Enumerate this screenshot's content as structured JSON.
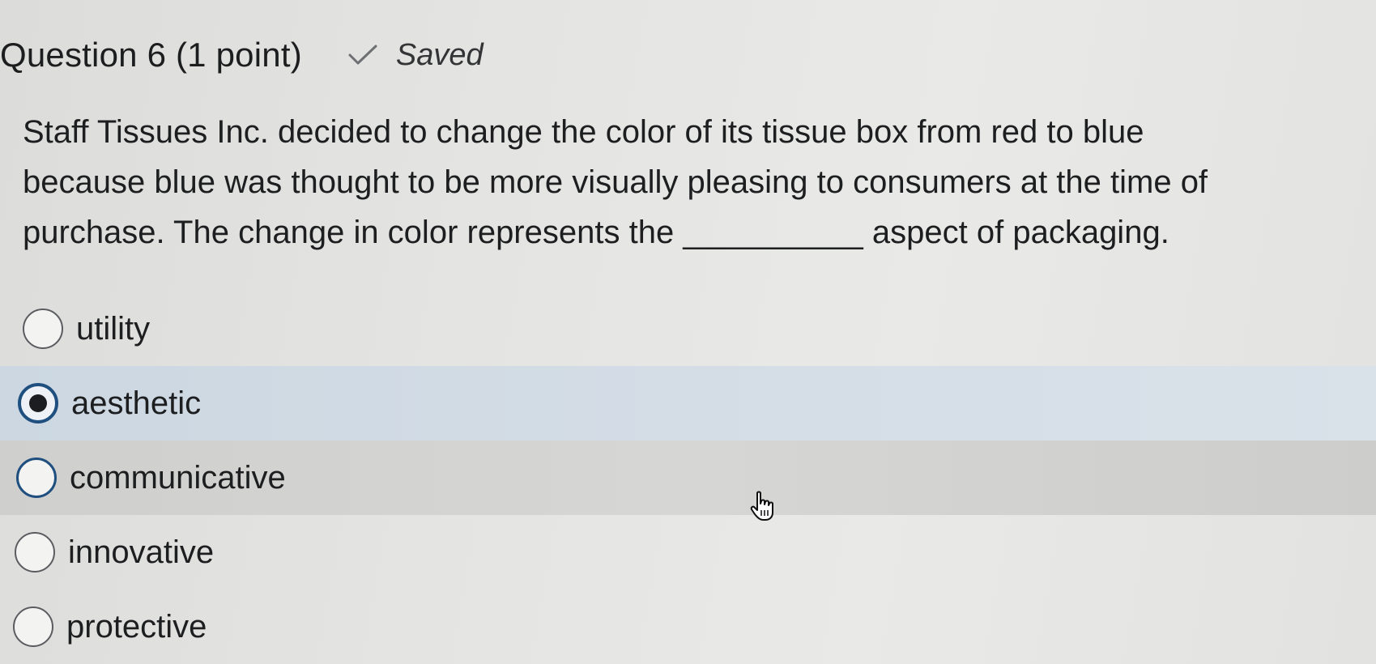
{
  "question": {
    "title": "Question 6 (1 point)",
    "status": "Saved",
    "status_icon": "check-icon",
    "stem_lines": [
      "Staff Tissues Inc. decided to change the color of its tissue box from red to blue",
      "because blue was thought to be more visually pleasing to consumers at the time of",
      "purchase. The change in color represents the __________ aspect of packaging."
    ]
  },
  "options": [
    {
      "label": "utility",
      "selected": false
    },
    {
      "label": "aesthetic",
      "selected": true
    },
    {
      "label": "communicative",
      "selected": false
    },
    {
      "label": "innovative",
      "selected": false
    },
    {
      "label": "protective",
      "selected": false
    }
  ],
  "colors": {
    "selected_bg": "#d4dde6",
    "accent": "#1f4f7f",
    "hover_bg": "#d6d6d4"
  },
  "cursor": "hand-pointer-icon"
}
